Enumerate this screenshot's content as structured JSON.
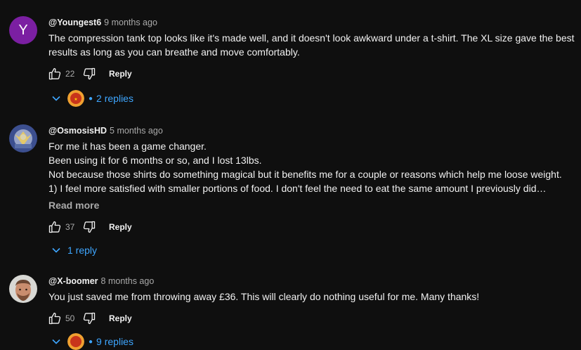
{
  "comments": [
    {
      "author": "@Youngest6",
      "time": "9 months ago",
      "avatar_letter": "Y",
      "lines": [
        "The compression tank top looks like it's made well, and it doesn't look awkward under a t-shirt. The XL size gave the best",
        "results as long as you can breathe and move comfortably."
      ],
      "likes": "22",
      "reply_label": "Reply",
      "replies_label": "2 replies"
    },
    {
      "author": "@OsmosisHD",
      "time": "5 months ago",
      "lines": [
        "For me it has been a game changer.",
        "Been using it for 6 months or so, and I lost 13lbs.",
        "Not because those shirts do something magical but it benefits me for a couple or reasons which help me loose weight.",
        "1) I feel more satisfied with smaller portions of food. I don't feel the need to eat the same amount I previously did…"
      ],
      "read_more": "Read more",
      "likes": "37",
      "reply_label": "Reply",
      "replies_label": "1 reply"
    },
    {
      "author": "@X-boomer",
      "time": "8 months ago",
      "lines": [
        "You just saved me from throwing away £36. This will clearly do nothing useful for me. Many thanks!"
      ],
      "likes": "50",
      "reply_label": "Reply",
      "replies_label": "9 replies"
    }
  ],
  "colors": {
    "background": "#0f0f0f",
    "text": "#f1f1f1",
    "secondary_text": "#aaaaaa",
    "link_blue": "#3ea6ff",
    "avatar_purple": "#7b1fa2"
  },
  "icons": {
    "like": "thumbs-up-icon",
    "dislike": "thumbs-down-icon",
    "expand": "chevron-down-icon"
  }
}
